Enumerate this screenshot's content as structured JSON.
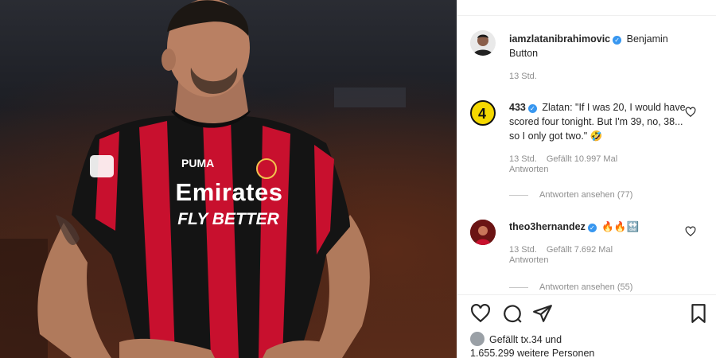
{
  "photo": {
    "sponsor_main": "Emirates",
    "sponsor_sub": "FLY BETTER"
  },
  "caption": {
    "username": "iamzlatanibrahimovic",
    "text": "Benjamin Button",
    "time": "13 Std."
  },
  "comments": [
    {
      "username": "433",
      "text": "Zlatan: \"If I was 20, I would have scored four tonight. But I'm 39, no, 38... so I only got two.\" 🤣",
      "time": "13 Std.",
      "likes": "Gefällt 10.997 Mal",
      "reply": "Antworten",
      "view_replies": "Antworten ansehen (77)"
    },
    {
      "username": "theo3hernandez",
      "text": "🔥🔥🔛",
      "time": "13 Std.",
      "likes": "Gefällt 7.692 Mal",
      "reply": "Antworten",
      "view_replies": "Antworten ansehen (55)"
    }
  ],
  "footer": {
    "liked_prefix": "Gefällt",
    "liked_user": "tx.34",
    "liked_and": "und",
    "liked_others": "1.655.299 weitere Personen"
  },
  "colors": {
    "verified": "#3897f0",
    "milan_red": "#c8102e",
    "milan_black": "#111111"
  },
  "icons": [
    "heart-icon",
    "comment-icon",
    "share-icon",
    "bookmark-icon",
    "verified-badge-icon"
  ]
}
